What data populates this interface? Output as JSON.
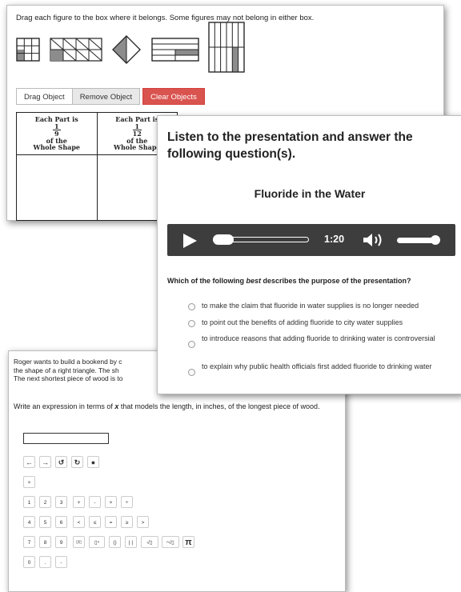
{
  "drag_panel": {
    "instruction": "Drag each figure to the box where it belongs.  Some figures may not belong in either box.",
    "buttons": {
      "drag": "Drag Object",
      "remove": "Remove Object",
      "clear": "Clear Objects"
    },
    "columns": [
      {
        "line1": "Each Part is",
        "num": "1",
        "den": "9",
        "line2": "of the",
        "line3": "Whole Shape"
      },
      {
        "line1": "Each Part is",
        "num": "1",
        "den": "12",
        "line2": "of the",
        "line3": "Whole Shape"
      }
    ]
  },
  "audio_panel": {
    "prompt": "Listen to the presentation and answer the following question(s).",
    "title": "Fluoride in the Water",
    "time": "1:20",
    "question_before": "Which of the following ",
    "question_em": "best",
    "question_after": " describes the purpose of the presentation?",
    "options": [
      "to make the claim that fluoride in water supplies is no longer needed",
      "to point out the benefits of adding fluoride to city water supplies",
      "to introduce reasons that adding fluoride to drinking water is controversial",
      "to explain why public health officials first added fluoride to drinking water"
    ]
  },
  "math_panel": {
    "problem_line1": "Roger wants to build a bookend by c",
    "problem_line2": "the shape of a right triangle.  The sh",
    "problem_line3": "The next shortest piece of wood is to",
    "write_before": "Write an expression in terms of ",
    "write_var": "x",
    "write_after": " that models the length, in inches, of the longest piece of wood.",
    "keys": {
      "nav": [
        "←",
        "→",
        "↺",
        "↻",
        "●"
      ],
      "clear": "×",
      "row1": [
        "1",
        "2",
        "3",
        "+",
        "-",
        "×",
        "÷"
      ],
      "row2": [
        "4",
        "5",
        "6",
        "<",
        "≤",
        "=",
        "≥",
        ">"
      ],
      "row3": [
        "7",
        "8",
        "9",
        "▯/▯",
        "▯ⁿ",
        "()",
        "| |",
        "√▯",
        "ⁿ√▯",
        "π"
      ],
      "row4": [
        "0",
        ".",
        "-"
      ]
    }
  }
}
